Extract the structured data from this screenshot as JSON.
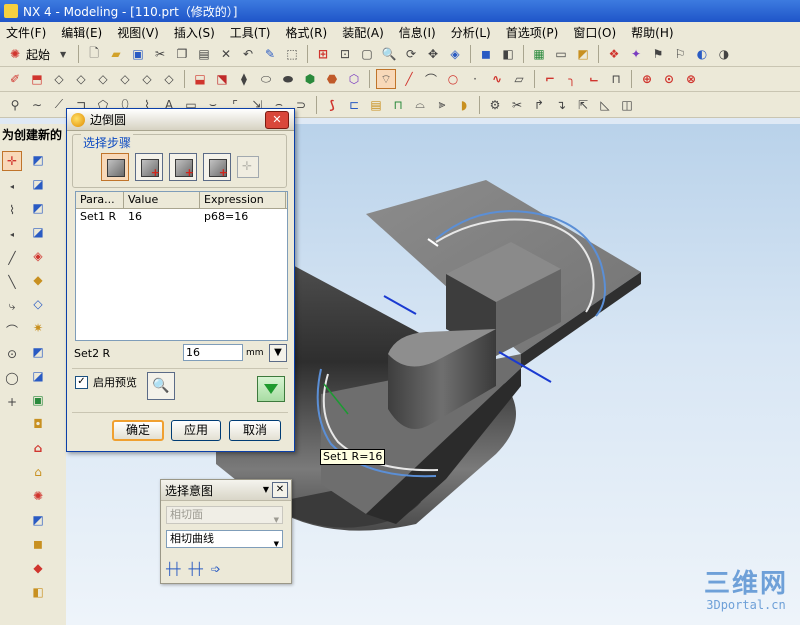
{
  "window": {
    "title": "NX 4 - Modeling - [110.prt（修改的）]"
  },
  "menu": [
    "文件(F)",
    "编辑(E)",
    "视图(V)",
    "插入(S)",
    "工具(T)",
    "格式(R)",
    "装配(A)",
    "信息(I)",
    "分析(L)",
    "首选项(P)",
    "窗口(O)",
    "帮助(H)"
  ],
  "toolbar": {
    "start_label": "起始"
  },
  "prompt": "为创建新的",
  "dialog": {
    "title": "边倒圆",
    "step_group_label": "选择步骤",
    "table": {
      "headers": [
        "Para...",
        "Value",
        "Expression"
      ],
      "rows": [
        [
          "Set1 R",
          "16",
          "p68=16"
        ]
      ]
    },
    "set2_label": "Set2 R",
    "set2_value": "16",
    "unit": "mm",
    "preview_label": "启用预览",
    "preview_checked": true,
    "buttons": {
      "ok": "确定",
      "apply": "应用",
      "cancel": "取消"
    }
  },
  "tooltip": "Set1 R=16",
  "selection_intent": {
    "title": "选择意图",
    "option1": "相切面",
    "option2": "相切曲线"
  },
  "watermark": {
    "brand": "三维网",
    "url": "3Dportal.cn"
  },
  "colors": {
    "title_blue": "#1f55c8",
    "dialog_face": "#ece9d8",
    "accent_blue": "#0d4bc2",
    "viewport_bg": "#c9ddf0"
  }
}
